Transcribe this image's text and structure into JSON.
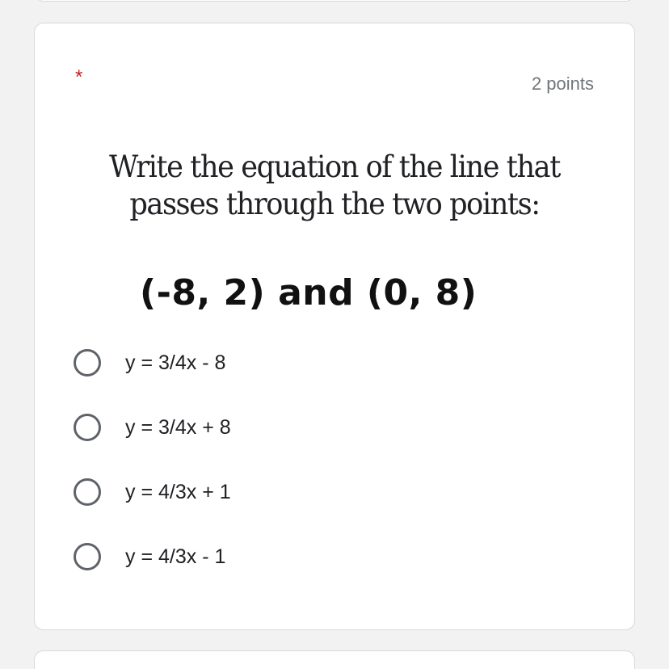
{
  "question": {
    "required_mark": "*",
    "points": "2 points",
    "prompt_line1": "Write the equation of the line that",
    "prompt_line2": "passes through the two points:",
    "points_given": "(-8, 2) and (0, 8)"
  },
  "options": [
    {
      "label": "y = 3/4x - 8"
    },
    {
      "label": "y = 3/4x + 8"
    },
    {
      "label": "y = 4/3x + 1"
    },
    {
      "label": "y = 4/3x - 1"
    }
  ],
  "colors": {
    "background": "#f2f2f2",
    "card": "#ffffff",
    "required": "#c5221f",
    "radio_border": "#5f6368",
    "points_text": "#70757a"
  },
  "icons": {
    "radio": "radio-unselected-icon"
  }
}
